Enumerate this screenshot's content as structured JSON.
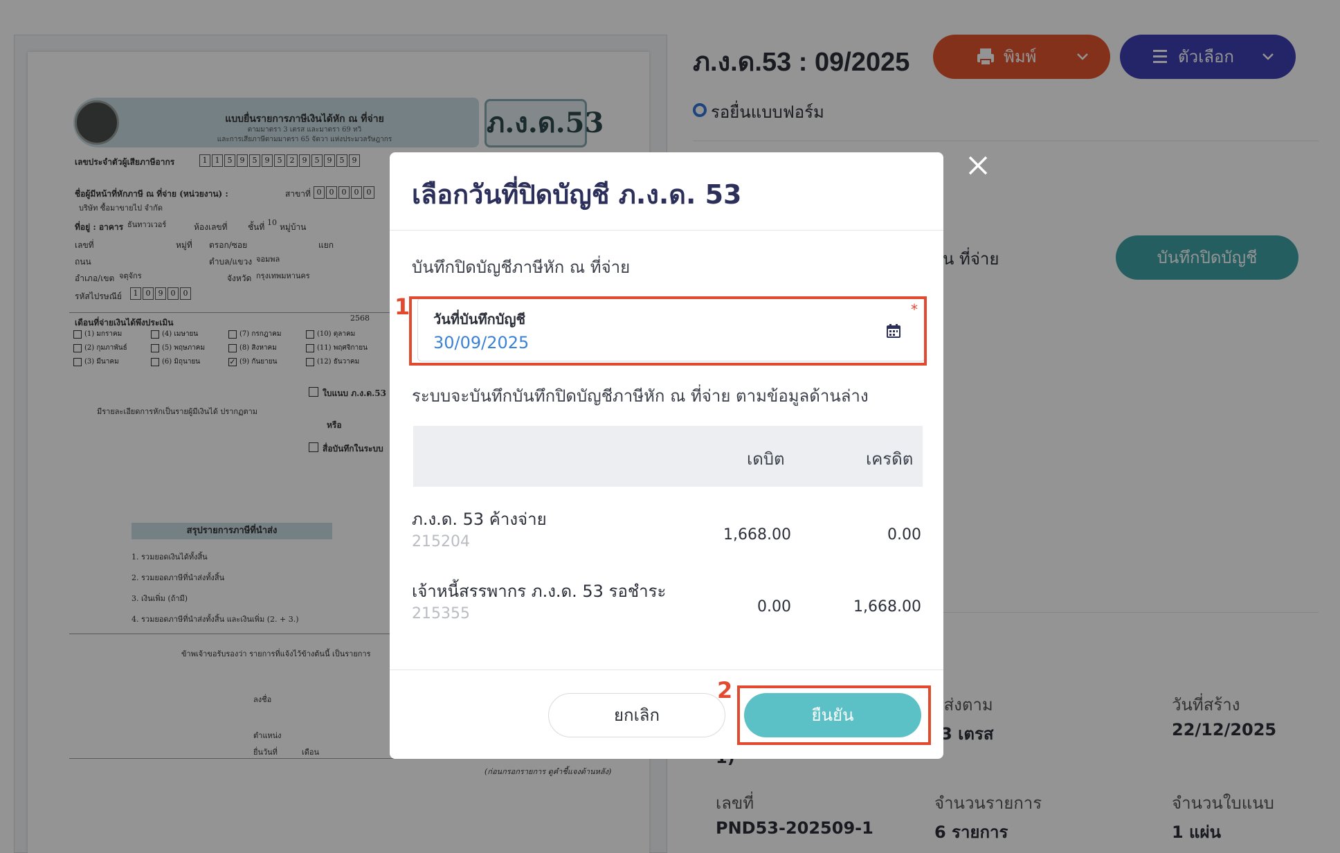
{
  "header": {
    "title": "ภ.ง.ด.53 : 09/2025",
    "status": "รอยื่นแบบฟอร์ม",
    "print_label": "พิมพ์",
    "options_label": "ตัวเลือก",
    "save_close_label": "บันทึกปิดบัญชี",
    "partial_text": "น ที่จ่าย"
  },
  "document": {
    "form_code": "ภ.ง.ด.53",
    "header_title": "แบบยื่นรายการภาษีเงินได้หัก ณ ที่จ่าย",
    "header_sub1": "ตามมาตรา 3 เตรส และมาตรา 69 ทวิ",
    "header_sub2": "และการเสียภาษีตามมาตรา 65 จัตวา แห่งประมวลรัษฎากร",
    "taxpayer_id_label": "เลขประจำตัวผู้เสียภาษีอากร",
    "taxpayer_id_digits": [
      "1",
      "1",
      "5",
      "9",
      "5",
      "9",
      "5",
      "2",
      "9",
      "5",
      "9",
      "5",
      "9"
    ],
    "payer_label": "ชื่อผู้มีหน้าที่หักภาษี ณ ที่จ่าย (หน่วยงาน) :",
    "branch_label": "สาขาที่",
    "branch_digits": [
      "0",
      "0",
      "0",
      "0",
      "0"
    ],
    "company_name": "บริษัท ซื้อมาขายไป จำกัด",
    "address_label": "ที่อยู่ : อาคาร",
    "building": "ธันทาวเวอร์",
    "room_label": "ห้องเลขที่",
    "floor_label": "ชั้นที่",
    "floor": "10",
    "village_label": "หมู่บ้าน",
    "no_label": "เลขที่",
    "moo_label": "หมู่ที่",
    "soi_label": "ตรอก/ซอย",
    "yaek_label": "แยก",
    "road_label": "ถนน",
    "subdistrict_label": "ตำบล/แขวง",
    "subdistrict": "จอมพล",
    "district_label": "อำเภอ/เขต",
    "district": "จตุจักร",
    "province_label": "จังหวัด",
    "province": "กรุงเทพมหานคร",
    "postcode_label": "รหัสไปรษณีย์",
    "postcode_digits": [
      "1",
      "0",
      "9",
      "0",
      "0"
    ],
    "month_label": "เดือนที่จ่ายเงินได้พึงประเมิน",
    "year": "2568",
    "months": [
      "(1) มกราคม",
      "(2) กุมภาพันธ์",
      "(3) มีนาคม",
      "(4) เมษายน",
      "(5) พฤษภาคม",
      "(6) มิถุนายน",
      "(7) กรกฎาคม",
      "(8) สิงหาคม",
      "(9) กันยายน",
      "(10) ตุลาคม",
      "(11) พฤศจิกายน",
      "(12) ธันวาคม"
    ],
    "attachment_label": "ใบแนบ ภ.ง.ด.53",
    "or_label": "หรือ",
    "media_label": "สื่อบันทึกในระบบ",
    "detail_text": "มีรายละเอียดการหักเป็นรายผู้มีเงินได้ ปรากฏตาม",
    "summary_title": "สรุปรายการภาษีที่นำส่ง",
    "summary_1": "1. รวมยอดเงินได้ทั้งสิ้น",
    "summary_2": "2. รวมยอดภาษีที่นำส่งทั้งสิ้น",
    "summary_3": "3. เงินเพิ่ม (ถ้ามี)",
    "summary_4": "4. รวมยอดภาษีที่นำส่งทั้งสิ้น และเงินเพิ่ม (2. + 3.)",
    "certify_text": "ข้าพเจ้าขอรับรองว่า รายการที่แจ้งไว้ข้างต้นนี้ เป็นรายการ",
    "sign_label": "ลงชื่อ",
    "position_label": "ตำแหน่ง",
    "filed_label": "ยื่นวันที่",
    "month_word": "เดือน",
    "footer_note": "(ก่อนกรอกรายการ ดูคำชี้แจงด้านหลัง)"
  },
  "info": {
    "created_label": "วันที่สร้าง",
    "created_value": "22/12/2025",
    "submit_label_partial": "ำส่งตาม",
    "submit_value_partial": ".3 เตรส",
    "submit_value_tail": "1)",
    "number_label": "เลขที่",
    "number_value": "PND53-202509-1",
    "items_label": "จำนวนรายการ",
    "items_value": "6 รายการ",
    "sheets_label": "จำนวนใบแนบ",
    "sheets_value": "1 แผ่น"
  },
  "modal": {
    "title": "เลือกวันที่ปิดบัญชี ภ.ง.ด. 53",
    "section_label": "บันทึกปิดบัญชีภาษีหัก ณ ที่จ่าย",
    "date_label": "วันที่บันทึกบัญชี",
    "date_value": "30/09/2025",
    "required_mark": "*",
    "note": "ระบบจะบันทึกบันทึกปิดบัญชีภาษีหัก ณ ที่จ่าย ตามข้อมูลด้านล่าง",
    "table": {
      "headers": [
        "",
        "เดบิต",
        "เครดิต"
      ],
      "rows": [
        {
          "name": "ภ.ง.ด. 53 ค้างจ่าย",
          "code": "215204",
          "debit": "1,668.00",
          "credit": "0.00"
        },
        {
          "name": "เจ้าหนี้สรรพากร ภ.ง.ด. 53 รอชำระ",
          "code": "215355",
          "debit": "0.00",
          "credit": "1,668.00"
        }
      ]
    },
    "cancel_label": "ยกเลิก",
    "confirm_label": "ยืนยัน"
  },
  "annotations": {
    "step1": "1",
    "step2": "2",
    "color": "#e14a2f"
  },
  "colors": {
    "print_button": "#e2552e",
    "options_button": "#3e3eb4",
    "confirm_button": "#5cc1c6",
    "date_value": "#3b82d6"
  }
}
